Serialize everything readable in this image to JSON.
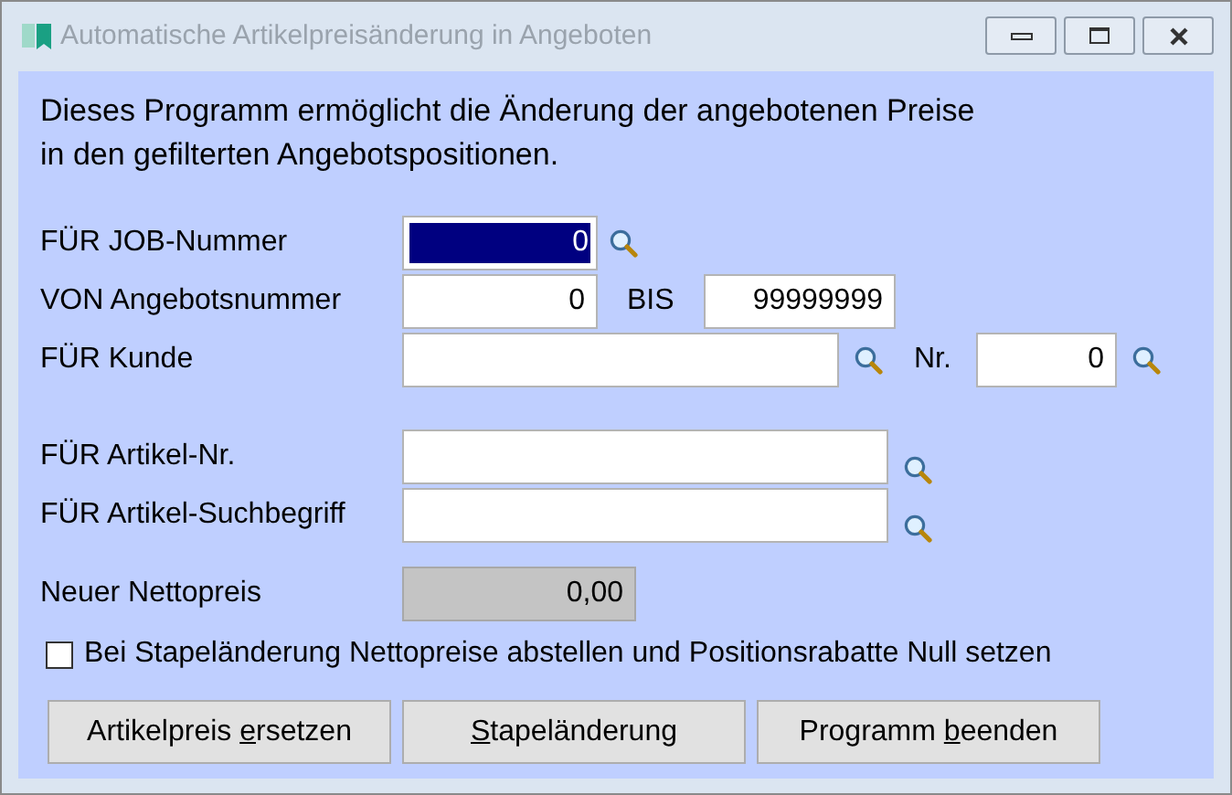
{
  "window": {
    "title": "Automatische Artikelpreisänderung in Angeboten"
  },
  "intro": [
    "Dieses Programm ermöglicht die Änderung der angebotenen Preise",
    "in den gefilterten Angebotspositionen."
  ],
  "job": {
    "label": "FÜR JOB-Nummer",
    "value": "0",
    "focused": true
  },
  "von": {
    "label": "VON Angebotsnummer",
    "value": "0",
    "bis_label": "BIS",
    "bis_value": "99999999"
  },
  "kunde": {
    "label": "FÜR Kunde",
    "nr_label": "Nr.",
    "nr_value": "0"
  },
  "artikel_nr": {
    "label": "FÜR Artikel-Nr."
  },
  "artikel_such": {
    "label": "FÜR Artikel-Suchbegriff"
  },
  "nettopreis": {
    "label": "Neuer Nettopreis",
    "value": "0,00",
    "disabled": true
  },
  "checkbox": {
    "label": "Bei Stapeländerung Nettopreise abstellen und Positionsrabatte Null setzen",
    "checked": false
  },
  "buttons": [
    {
      "before": "Artikelpreis ",
      "accel": "e",
      "after": "rsetzen"
    },
    {
      "accel": "S",
      "after": "tapeländerung"
    },
    {
      "before": "Programm ",
      "accel": "b",
      "after": "eenden"
    }
  ]
}
